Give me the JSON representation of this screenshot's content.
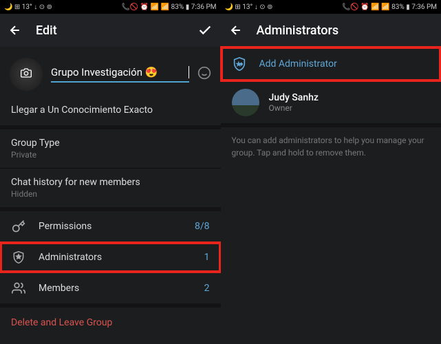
{
  "status": {
    "left": "🌙 ⊞ 13° ↓ ⊙ ⊚",
    "right": "📞🚫 ⏰ 📶 📶 83% ▮ 7:36 PM"
  },
  "left": {
    "title": "Edit",
    "group_name": "Grupo Investigación 😍",
    "description": "Llegar a Un Conocimiento Exacto",
    "group_type": {
      "label": "Group Type",
      "value": "Private"
    },
    "chat_history": {
      "label": "Chat history for new members",
      "value": "Hidden"
    },
    "permissions": {
      "label": "Permissions",
      "count": "8/8"
    },
    "administrators": {
      "label": "Administrators",
      "count": "1"
    },
    "members": {
      "label": "Members",
      "count": "2"
    },
    "delete": "Delete and Leave Group"
  },
  "right": {
    "title": "Administrators",
    "add": "Add Administrator",
    "owner": {
      "name": "Judy Sanhz",
      "role": "Owner"
    },
    "help": "You can add administrators to help you manage your group. Tap and hold to remove them."
  }
}
